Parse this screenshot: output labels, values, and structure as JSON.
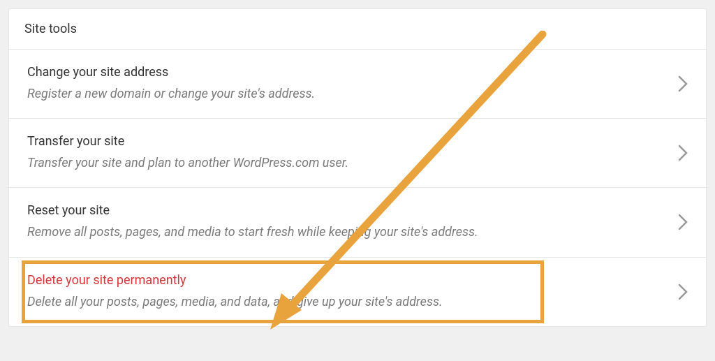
{
  "panel": {
    "title": "Site tools",
    "items": [
      {
        "title": "Change your site address",
        "desc": "Register a new domain or change your site's address.",
        "danger": false
      },
      {
        "title": "Transfer your site",
        "desc": "Transfer your site and plan to another WordPress.com user.",
        "danger": false
      },
      {
        "title": "Reset your site",
        "desc": "Remove all posts, pages, and media to start fresh while keeping your site's address.",
        "danger": false
      },
      {
        "title": "Delete your site permanently",
        "desc": "Delete all your posts, pages, media, and data, and give up your site's address.",
        "danger": true
      }
    ]
  },
  "annotation": {
    "highlight_color": "#e8a33d"
  }
}
